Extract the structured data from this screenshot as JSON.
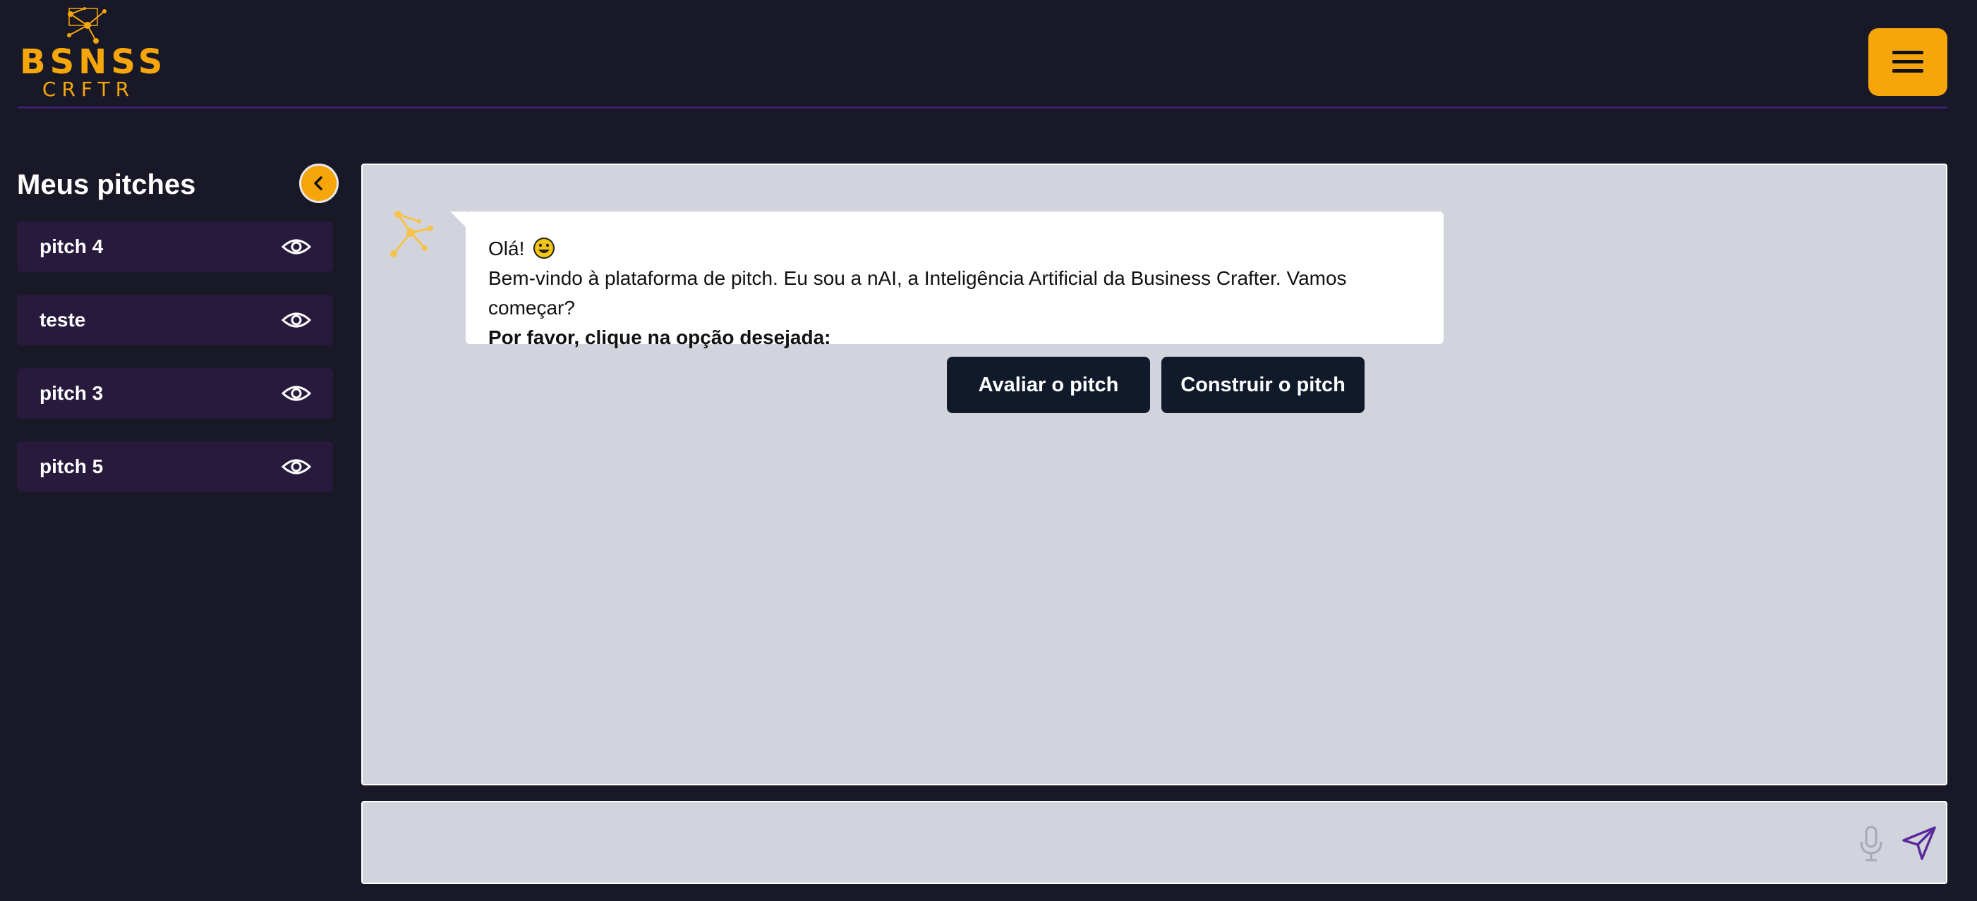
{
  "header": {
    "logo": {
      "line1": "BSNSS",
      "line2": "CRFTR"
    },
    "menu_icon": "hamburger-icon"
  },
  "sidebar": {
    "title": "Meus pitches",
    "collapse_icon": "chevron-left-icon",
    "items": [
      {
        "label": "pitch 4",
        "icon": "eye-icon"
      },
      {
        "label": "teste",
        "icon": "eye-icon"
      },
      {
        "label": "pitch 3",
        "icon": "eye-icon"
      },
      {
        "label": "pitch 5",
        "icon": "eye-icon"
      }
    ]
  },
  "chat": {
    "message": {
      "greeting": "Olá!",
      "emoji": "smiley-emoji",
      "body": "Bem-vindo à plataforma de pitch. Eu sou a nAI, a Inteligência Artificial da Business Crafter. Vamos começar?",
      "prompt": "Por favor, clique na opção desejada:"
    },
    "options": [
      {
        "label": "Avaliar o pitch"
      },
      {
        "label": "Construir o pitch"
      }
    ]
  },
  "input": {
    "value": "",
    "placeholder": "",
    "mic_icon": "microphone-icon",
    "send_icon": "send-icon"
  },
  "colors": {
    "background": "#181826",
    "accent": "#f6a60a",
    "sidebar_item": "#271a3d",
    "chat_panel": "#d1d4dd",
    "button_dark": "#111a2b",
    "divider": "#3a1f73",
    "send": "#5b2a9a"
  }
}
